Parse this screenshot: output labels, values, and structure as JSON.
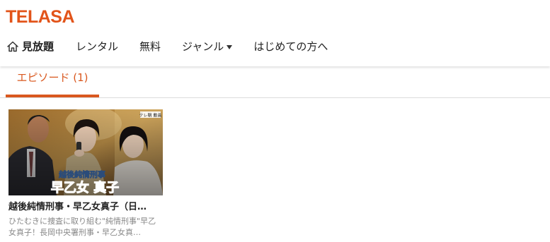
{
  "brand": {
    "logo_text": "TELASA",
    "accent_color": "#d9581f"
  },
  "nav": {
    "items": [
      {
        "label": "見放題",
        "icon": "home-icon"
      },
      {
        "label": "レンタル"
      },
      {
        "label": "無料"
      },
      {
        "label": "ジャンル",
        "icon": "caret-down-icon"
      },
      {
        "label": "はじめての方へ"
      }
    ]
  },
  "tabs": [
    {
      "label": "エピソード (1)",
      "active": true
    }
  ],
  "episodes": [
    {
      "title": "越後純情刑事・早乙女真子（日本テレビ）",
      "title_display": "越後純情刑事・早乙女真子（日…",
      "description_display": "ひたむきに捜査に取り組む\"純情刑事\"早乙女真子！長岡中央署刑事・早乙女真…",
      "thumbnail": {
        "badge": "テレ朝 動画",
        "subtitle_text": "越後純情刑事",
        "title_text": "早乙女 真子"
      }
    }
  ]
}
